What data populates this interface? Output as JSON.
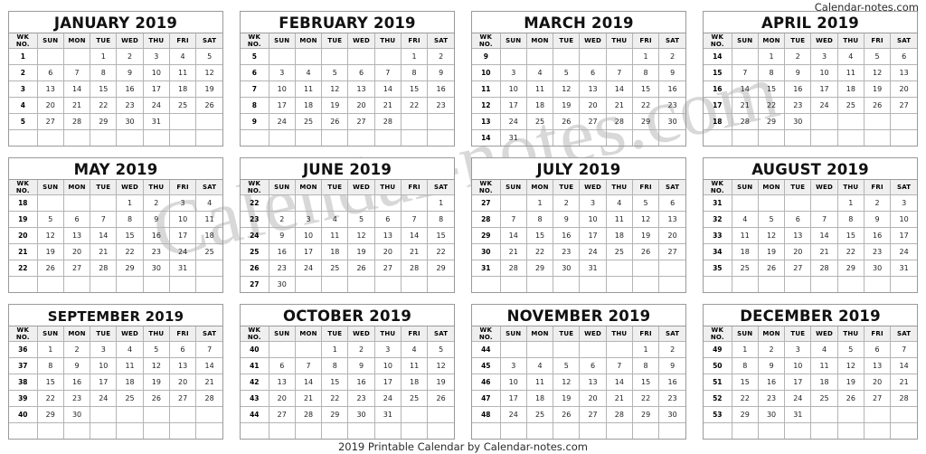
{
  "header": {
    "site_label": "Calendar-notes.com"
  },
  "watermark": {
    "text": "Calendar-notes.com"
  },
  "footer": {
    "text": "2019 Printable Calendar by Calendar-notes.com"
  },
  "columns": [
    "WK NO.",
    "SUN",
    "MON",
    "TUE",
    "WED",
    "THU",
    "FRI",
    "SAT"
  ],
  "year": "2019",
  "months": [
    {
      "title": "JANUARY 2019",
      "name": "January",
      "rows": [
        [
          "1",
          "",
          "",
          "1",
          "2",
          "3",
          "4",
          "5"
        ],
        [
          "2",
          "6",
          "7",
          "8",
          "9",
          "10",
          "11",
          "12"
        ],
        [
          "3",
          "13",
          "14",
          "15",
          "16",
          "17",
          "18",
          "19"
        ],
        [
          "4",
          "20",
          "21",
          "22",
          "23",
          "24",
          "25",
          "26"
        ],
        [
          "5",
          "27",
          "28",
          "29",
          "30",
          "31",
          "",
          ""
        ],
        [
          "",
          "",
          "",
          "",
          "",
          "",
          "",
          ""
        ]
      ]
    },
    {
      "title": "FEBRUARY 2019",
      "name": "February",
      "rows": [
        [
          "5",
          "",
          "",
          "",
          "",
          "",
          "1",
          "2"
        ],
        [
          "6",
          "3",
          "4",
          "5",
          "6",
          "7",
          "8",
          "9"
        ],
        [
          "7",
          "10",
          "11",
          "12",
          "13",
          "14",
          "15",
          "16"
        ],
        [
          "8",
          "17",
          "18",
          "19",
          "20",
          "21",
          "22",
          "23"
        ],
        [
          "9",
          "24",
          "25",
          "26",
          "27",
          "28",
          "",
          ""
        ],
        [
          "",
          "",
          "",
          "",
          "",
          "",
          "",
          ""
        ]
      ]
    },
    {
      "title": "MARCH 2019",
      "name": "March",
      "rows": [
        [
          "9",
          "",
          "",
          "",
          "",
          "",
          "1",
          "2"
        ],
        [
          "10",
          "3",
          "4",
          "5",
          "6",
          "7",
          "8",
          "9"
        ],
        [
          "11",
          "10",
          "11",
          "12",
          "13",
          "14",
          "15",
          "16"
        ],
        [
          "12",
          "17",
          "18",
          "19",
          "20",
          "21",
          "22",
          "23"
        ],
        [
          "13",
          "24",
          "25",
          "26",
          "27",
          "28",
          "29",
          "30"
        ],
        [
          "14",
          "31",
          "",
          "",
          "",
          "",
          "",
          ""
        ]
      ]
    },
    {
      "title": "APRIL 2019",
      "name": "April",
      "rows": [
        [
          "14",
          "",
          "1",
          "2",
          "3",
          "4",
          "5",
          "6"
        ],
        [
          "15",
          "7",
          "8",
          "9",
          "10",
          "11",
          "12",
          "13"
        ],
        [
          "16",
          "14",
          "15",
          "16",
          "17",
          "18",
          "19",
          "20"
        ],
        [
          "17",
          "21",
          "22",
          "23",
          "24",
          "25",
          "26",
          "27"
        ],
        [
          "18",
          "28",
          "29",
          "30",
          "",
          "",
          "",
          ""
        ],
        [
          "",
          "",
          "",
          "",
          "",
          "",
          "",
          ""
        ]
      ]
    },
    {
      "title": "MAY 2019",
      "name": "May",
      "rows": [
        [
          "18",
          "",
          "",
          "",
          "1",
          "2",
          "3",
          "4"
        ],
        [
          "19",
          "5",
          "6",
          "7",
          "8",
          "9",
          "10",
          "11"
        ],
        [
          "20",
          "12",
          "13",
          "14",
          "15",
          "16",
          "17",
          "18"
        ],
        [
          "21",
          "19",
          "20",
          "21",
          "22",
          "23",
          "24",
          "25"
        ],
        [
          "22",
          "26",
          "27",
          "28",
          "29",
          "30",
          "31",
          ""
        ],
        [
          "",
          "",
          "",
          "",
          "",
          "",
          "",
          ""
        ]
      ]
    },
    {
      "title": "JUNE 2019",
      "name": "June",
      "rows": [
        [
          "22",
          "",
          "",
          "",
          "",
          "",
          "",
          "1"
        ],
        [
          "23",
          "2",
          "3",
          "4",
          "5",
          "6",
          "7",
          "8"
        ],
        [
          "24",
          "9",
          "10",
          "11",
          "12",
          "13",
          "14",
          "15"
        ],
        [
          "25",
          "16",
          "17",
          "18",
          "19",
          "20",
          "21",
          "22"
        ],
        [
          "26",
          "23",
          "24",
          "25",
          "26",
          "27",
          "28",
          "29"
        ],
        [
          "27",
          "30",
          "",
          "",
          "",
          "",
          "",
          ""
        ]
      ]
    },
    {
      "title": "JULY 2019",
      "name": "July",
      "rows": [
        [
          "27",
          "",
          "1",
          "2",
          "3",
          "4",
          "5",
          "6"
        ],
        [
          "28",
          "7",
          "8",
          "9",
          "10",
          "11",
          "12",
          "13"
        ],
        [
          "29",
          "14",
          "15",
          "16",
          "17",
          "18",
          "19",
          "20"
        ],
        [
          "30",
          "21",
          "22",
          "23",
          "24",
          "25",
          "26",
          "27"
        ],
        [
          "31",
          "28",
          "29",
          "30",
          "31",
          "",
          "",
          ""
        ],
        [
          "",
          "",
          "",
          "",
          "",
          "",
          "",
          ""
        ]
      ]
    },
    {
      "title": "AUGUST 2019",
      "name": "August",
      "rows": [
        [
          "31",
          "",
          "",
          "",
          "",
          "1",
          "2",
          "3"
        ],
        [
          "32",
          "4",
          "5",
          "6",
          "7",
          "8",
          "9",
          "10"
        ],
        [
          "33",
          "11",
          "12",
          "13",
          "14",
          "15",
          "16",
          "17"
        ],
        [
          "34",
          "18",
          "19",
          "20",
          "21",
          "22",
          "23",
          "24"
        ],
        [
          "35",
          "25",
          "26",
          "27",
          "28",
          "29",
          "30",
          "31"
        ],
        [
          "",
          "",
          "",
          "",
          "",
          "",
          "",
          ""
        ]
      ]
    },
    {
      "title": "SEPTEMBER 2019",
      "name": "September",
      "rows": [
        [
          "36",
          "1",
          "2",
          "3",
          "4",
          "5",
          "6",
          "7"
        ],
        [
          "37",
          "8",
          "9",
          "10",
          "11",
          "12",
          "13",
          "14"
        ],
        [
          "38",
          "15",
          "16",
          "17",
          "18",
          "19",
          "20",
          "21"
        ],
        [
          "39",
          "22",
          "23",
          "24",
          "25",
          "26",
          "27",
          "28"
        ],
        [
          "40",
          "29",
          "30",
          "",
          "",
          "",
          "",
          ""
        ],
        [
          "",
          "",
          "",
          "",
          "",
          "",
          "",
          ""
        ]
      ]
    },
    {
      "title": "OCTOBER 2019",
      "name": "October",
      "rows": [
        [
          "40",
          "",
          "",
          "1",
          "2",
          "3",
          "4",
          "5"
        ],
        [
          "41",
          "6",
          "7",
          "8",
          "9",
          "10",
          "11",
          "12"
        ],
        [
          "42",
          "13",
          "14",
          "15",
          "16",
          "17",
          "18",
          "19"
        ],
        [
          "43",
          "20",
          "21",
          "22",
          "23",
          "24",
          "25",
          "26"
        ],
        [
          "44",
          "27",
          "28",
          "29",
          "30",
          "31",
          "",
          ""
        ],
        [
          "",
          "",
          "",
          "",
          "",
          "",
          "",
          ""
        ]
      ]
    },
    {
      "title": "NOVEMBER 2019",
      "name": "November",
      "rows": [
        [
          "44",
          "",
          "",
          "",
          "",
          "",
          "1",
          "2"
        ],
        [
          "45",
          "3",
          "4",
          "5",
          "6",
          "7",
          "8",
          "9"
        ],
        [
          "46",
          "10",
          "11",
          "12",
          "13",
          "14",
          "15",
          "16"
        ],
        [
          "47",
          "17",
          "18",
          "19",
          "20",
          "21",
          "22",
          "23"
        ],
        [
          "48",
          "24",
          "25",
          "26",
          "27",
          "28",
          "29",
          "30"
        ],
        [
          "",
          "",
          "",
          "",
          "",
          "",
          "",
          ""
        ]
      ]
    },
    {
      "title": "DECEMBER 2019",
      "name": "December",
      "rows": [
        [
          "49",
          "1",
          "2",
          "3",
          "4",
          "5",
          "6",
          "7"
        ],
        [
          "50",
          "8",
          "9",
          "10",
          "11",
          "12",
          "13",
          "14"
        ],
        [
          "51",
          "15",
          "16",
          "17",
          "18",
          "19",
          "20",
          "21"
        ],
        [
          "52",
          "22",
          "23",
          "24",
          "25",
          "26",
          "27",
          "28"
        ],
        [
          "53",
          "29",
          "30",
          "31",
          "",
          "",
          "",
          ""
        ],
        [
          "",
          "",
          "",
          "",
          "",
          "",
          "",
          ""
        ]
      ]
    }
  ]
}
